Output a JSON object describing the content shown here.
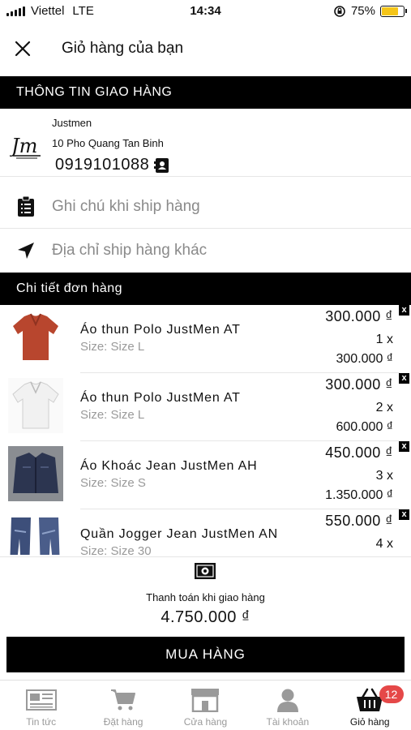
{
  "status_bar": {
    "carrier": "Viettel",
    "network": "LTE",
    "time": "14:34",
    "battery": "75%",
    "battery_level": 0.75
  },
  "header": {
    "title": "Giỏ hàng của bạn"
  },
  "delivery": {
    "section_title": "THÔNG TIN GIAO HÀNG",
    "name": "Justmen",
    "address": "10 Pho Quang Tan Binh",
    "phone": "0919101088",
    "note_placeholder": "Ghi chú khi ship hàng",
    "other_address": "Địa chỉ ship hàng khác"
  },
  "order": {
    "section_title": "Chi tiết đơn hàng",
    "items": [
      {
        "name": "Áo thun Polo JustMen AT",
        "size": "Size: Size L",
        "price": "300.000 ₫",
        "qty": "1 x",
        "total": "300.000 ₫"
      },
      {
        "name": "Áo thun Polo JustMen AT",
        "size": "Size: Size L",
        "price": "300.000 ₫",
        "qty": "2 x",
        "total": "600.000 ₫"
      },
      {
        "name": "Áo Khoác Jean JustMen AH",
        "size": "Size: Size S",
        "price": "450.000 ₫",
        "qty": "3 x",
        "total": "1.350.000 ₫"
      },
      {
        "name": "Quần Jogger Jean JustMen AN",
        "size": "Size: Size 30",
        "price": "550.000 ₫",
        "qty": "4 x",
        "total": ""
      }
    ]
  },
  "payment": {
    "method": "Thanh toán khi giao hàng",
    "amount": "4.750.000 ₫"
  },
  "buy_button": {
    "label": "MUA HÀNG"
  },
  "tabs": [
    {
      "label": "Tin tức",
      "icon": "newspaper-icon"
    },
    {
      "label": "Đặt hàng",
      "icon": "cart-icon"
    },
    {
      "label": "Cửa hàng",
      "icon": "store-icon"
    },
    {
      "label": "Tài khoản",
      "icon": "user-icon"
    },
    {
      "label": "Giỏ hàng",
      "icon": "basket-icon",
      "badge": "12"
    }
  ],
  "colors": {
    "bar": "#000000",
    "badge": "#e54848",
    "muted": "#9a9a9a"
  }
}
